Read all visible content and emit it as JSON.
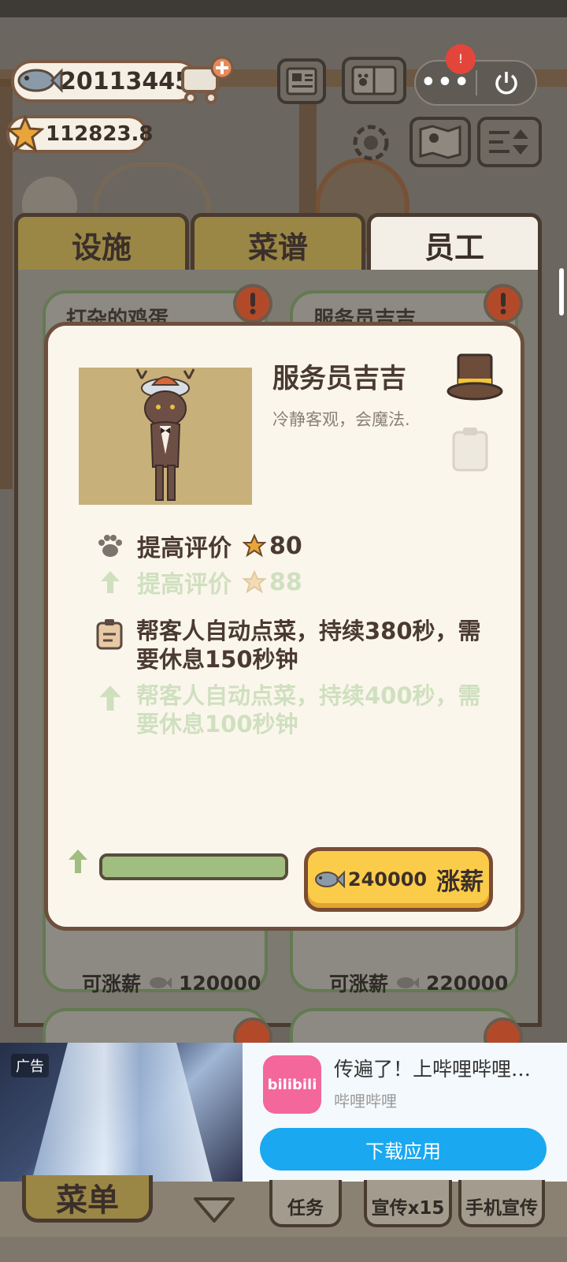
{
  "hud": {
    "fish_currency": "20113445",
    "star_currency": "112823.8",
    "notification_badge": "!"
  },
  "tabs": [
    {
      "label": "设施",
      "active": false
    },
    {
      "label": "菜谱",
      "active": false
    },
    {
      "label": "员工",
      "active": true
    }
  ],
  "background_cards": [
    {
      "title": "打杂的鸡蛋",
      "salary_label": "可涨薪",
      "salary_amount": "120000"
    },
    {
      "title": "服务员吉吉",
      "salary_label": "可涨薪",
      "salary_amount": "220000"
    }
  ],
  "modal": {
    "name": "服务员吉吉",
    "description": "冷静客观，会魔法.",
    "stat_label": "提高评价",
    "stat_current": "80",
    "stat_next": "88",
    "skill_current": "帮客人自动点菜，持续380秒，需要休息150秒钟",
    "skill_next": "帮客人自动点菜，持续400秒，需要休息100秒钟",
    "progress_fraction": 1.0,
    "raise_cost": "240000",
    "raise_label": "涨薪"
  },
  "ad": {
    "tag": "广告",
    "headline": "传遍了！上哔哩哔哩…",
    "brand": "哔哩哔哩",
    "logo_text": "bilibili",
    "cta": "下载应用"
  },
  "bottom_bar": {
    "menu": "菜单",
    "task": "任务",
    "promo": "宣传x15",
    "phone_promo": "手机宣传"
  },
  "colors": {
    "accent_yellow": "#fbcc4a",
    "tab_gold": "#9a8745",
    "progress_green": "#9fbe80",
    "upgrade_green": "#cfe0bf",
    "ad_blue": "#1aa8f0"
  }
}
